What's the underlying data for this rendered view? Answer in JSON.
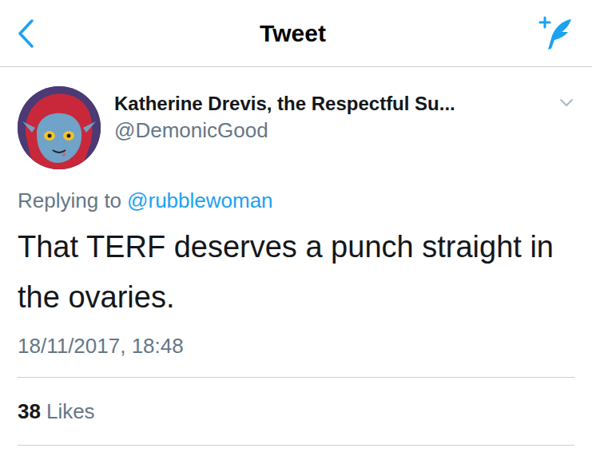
{
  "header": {
    "title": "Tweet"
  },
  "author": {
    "name": "Katherine Drevis, the Respectful Su...",
    "handle": "@DemonicGood"
  },
  "reply": {
    "label": "Replying to",
    "handle": "@rubblewoman"
  },
  "tweet": {
    "text": "That TERF deserves a punch straight in the ovaries.",
    "timestamp": "18/11/2017, 18:48"
  },
  "stats": {
    "count": "38",
    "label": "Likes"
  }
}
